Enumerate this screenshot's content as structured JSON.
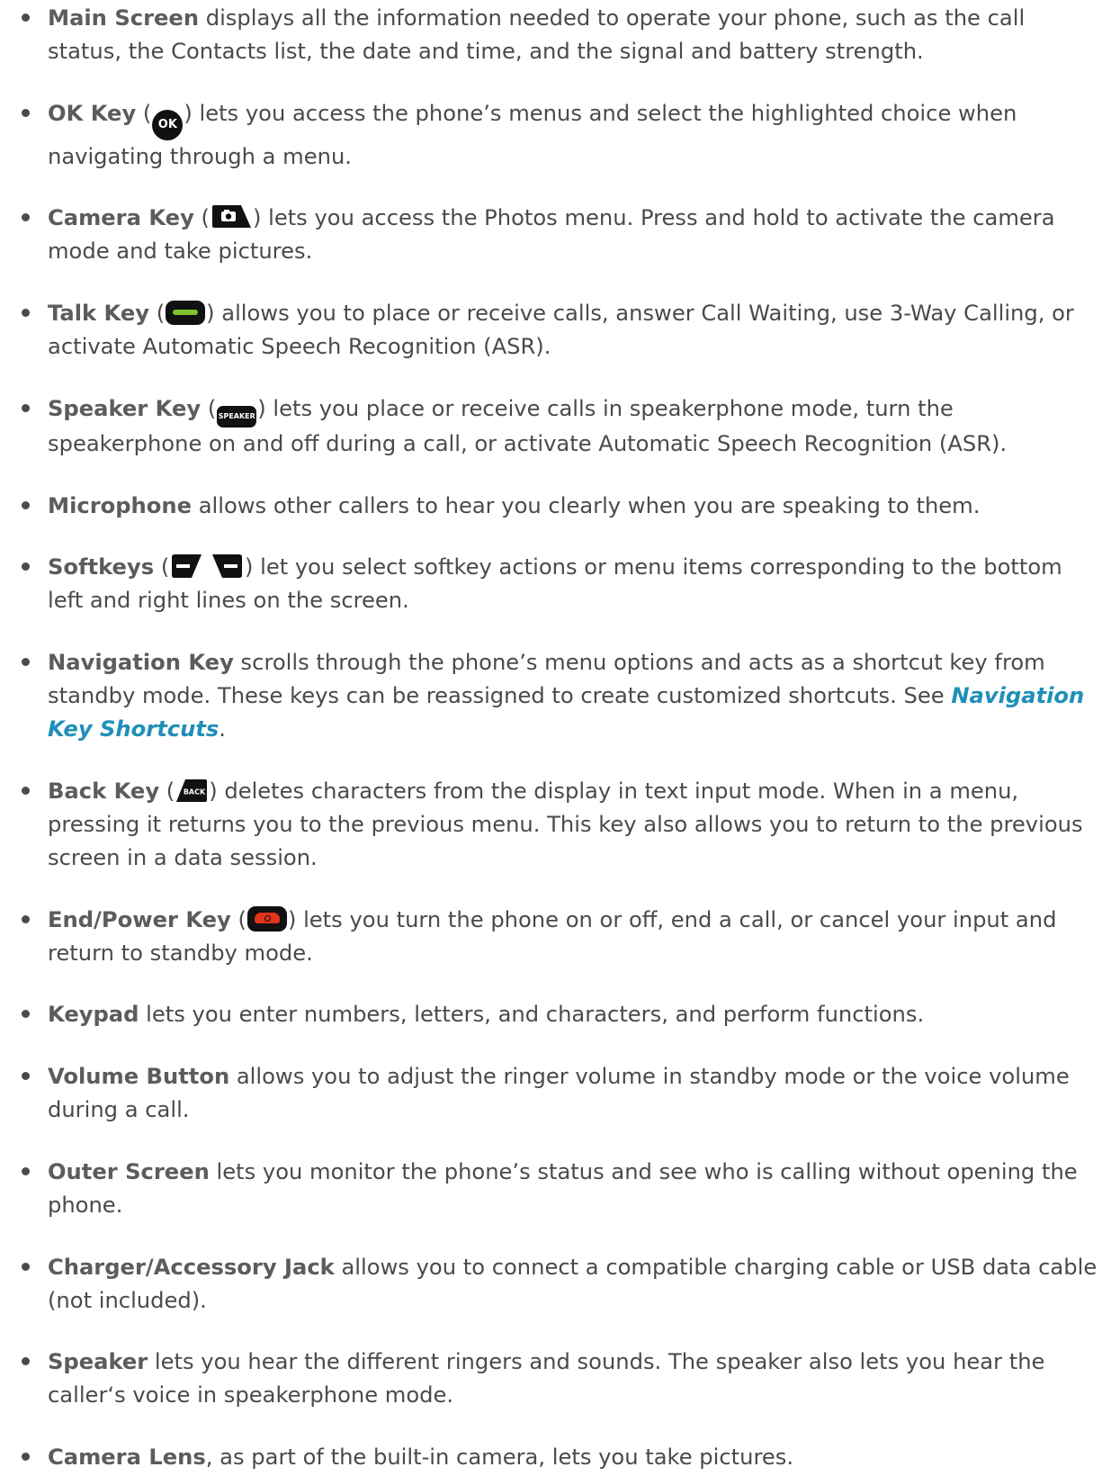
{
  "items": [
    {
      "term": "Main Screen",
      "desc": " displays all the information needed to operate your phone, such as the call status, the Contacts list, the date and time, and the signal and battery strength."
    },
    {
      "term": "OK Key",
      "icon_label": "OK",
      "desc": " lets you access the phone’s menus and select the highlighted choice when navigating through a menu."
    },
    {
      "term": "Camera Key",
      "desc": " lets you access the Photos menu. Press and hold to activate the camera mode and take pictures."
    },
    {
      "term": "Talk Key",
      "desc": " allows you to place or receive calls, answer Call Waiting, use 3-Way Calling, or activate Automatic Speech Recognition (ASR)."
    },
    {
      "term": "Speaker Key",
      "icon_label": "SPEAKER",
      "desc": " lets you place or receive calls in speakerphone mode, turn the speakerphone on and off during a call, or activate Automatic Speech Recognition (ASR)."
    },
    {
      "term": "Microphone",
      "desc": " allows other callers to hear you clearly when you are speaking to them."
    },
    {
      "term": "Softkeys",
      "desc": " let you select softkey actions or menu items corresponding to the bottom left and right lines on the screen."
    },
    {
      "term": "Navigation Key",
      "desc": " scrolls through the phone’s menu options and acts as a shortcut key from standby mode. These keys can be reassigned to create customized shortcuts. See ",
      "link": "Navigation Key Shortcuts",
      "desc_after": "."
    },
    {
      "term": "Back Key",
      "icon_label": "BACK",
      "desc": " deletes characters from the display in text input mode. When in a menu, pressing it returns you to the previous menu. This key also allows you to return to the previous screen in a data session."
    },
    {
      "term": "End/Power Key",
      "desc": " lets you turn the phone on or off, end a call, or cancel your input and return to standby mode."
    },
    {
      "term": "Keypad",
      "desc": " lets you enter numbers, letters, and characters, and perform functions."
    },
    {
      "term": "Volume Button",
      "desc": " allows you to adjust the ringer volume in standby mode or the voice volume during a call."
    },
    {
      "term": "Outer Screen",
      "desc": " lets you monitor the phone’s status and see who is calling without opening the phone."
    },
    {
      "term": "Charger/Accessory Jack",
      "desc": " allows you to connect a compatible charging cable or USB data cable (not included)."
    },
    {
      "term": "Speaker",
      "desc": " lets you hear the different ringers and sounds. The speaker also lets you hear the caller‘s voice in speakerphone mode."
    },
    {
      "term": "Camera Lens",
      "desc": ", as part of the built-in camera, lets you take pictures."
    }
  ],
  "colors": {
    "text": "#4a4a4a",
    "term": "#5c5c5c",
    "link": "#1f8fb8",
    "talk_green": "#7cc52a",
    "end_red": "#e2331d"
  },
  "icons": {
    "ok": "ok-key-icon",
    "camera": "camera-key-icon",
    "talk": "talk-key-icon",
    "speaker": "speaker-key-icon",
    "softkeys": "softkey-icons",
    "back": "back-key-icon",
    "end": "end-power-key-icon"
  }
}
